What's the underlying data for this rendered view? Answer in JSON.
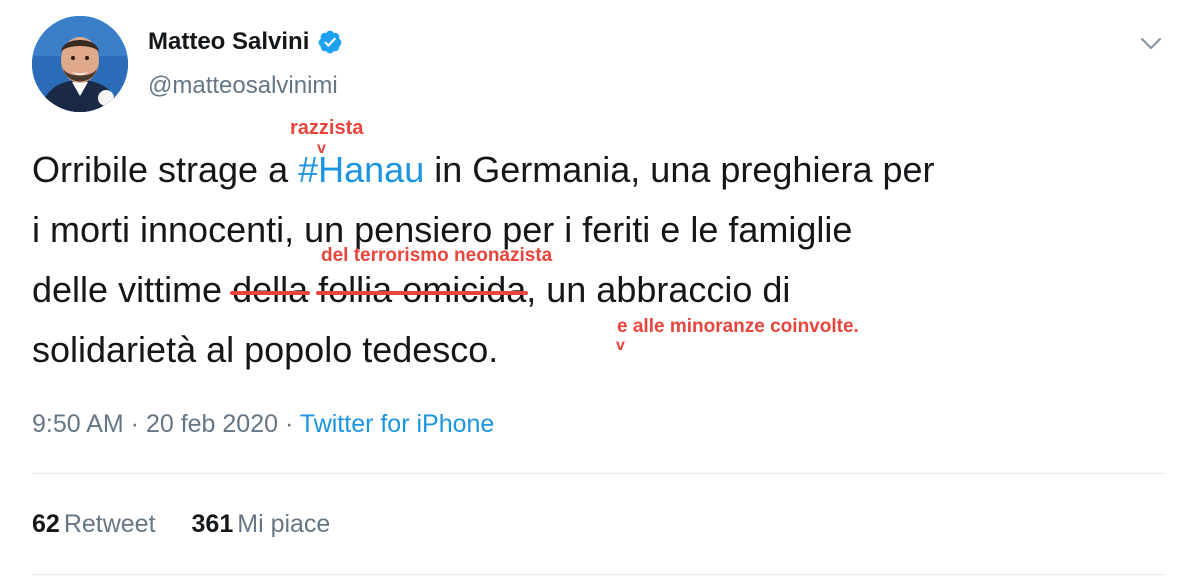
{
  "author": {
    "display_name": "Matteo Salvini",
    "handle": "@matteosalvinimi",
    "verified": true
  },
  "tweet": {
    "line1_a": "Orribile strage ",
    "line1_b": "a ",
    "hashtag": "#Hanau",
    "line1_c": " in Germania, una preghiera per",
    "line2": "i morti innocenti, un pensiero per i feriti e le famiglie",
    "line3_a": "delle vittime ",
    "struck_1": "della",
    "line3_space": " ",
    "struck_2": "follia omicida",
    "line3_b": ", un abbraccio di",
    "line4": "solidarietà al popolo tedesco."
  },
  "annotations": {
    "razzista": "razzista",
    "caret": "v",
    "terrorismo": "del terrorismo neonazista",
    "minoranze": "e alle minoranze coinvolte."
  },
  "meta": {
    "time": "9:50 AM",
    "separator_1": " · ",
    "date": "20 feb 2020",
    "separator_2": " · ",
    "source": "Twitter for iPhone"
  },
  "stats": {
    "retweets_count": "62",
    "retweets_label": "Retweet",
    "likes_count": "361",
    "likes_label": "Mi piace"
  },
  "icons": {
    "verified": "verified-badge-icon",
    "menu": "chevron-down-icon"
  },
  "colors": {
    "link": "#1b95e0",
    "annotation": "#e8453c",
    "secondary_text": "#657786",
    "primary_text": "#14171a"
  }
}
